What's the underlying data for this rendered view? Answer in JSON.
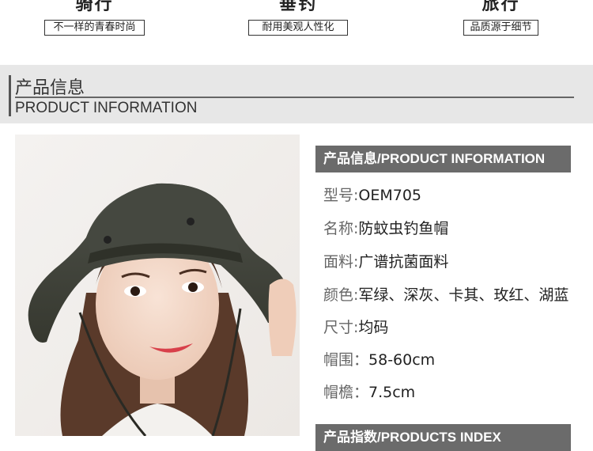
{
  "features": [
    {
      "name": "骑行",
      "tag": "不一样的青春时尚"
    },
    {
      "name": "垂钓",
      "tag": "耐用美观人性化"
    },
    {
      "name": "旅行",
      "tag": "品质源于细节"
    }
  ],
  "section": {
    "title_cn": "产品信息",
    "title_en": "PRODUCT INFORMATION"
  },
  "panel": {
    "header": "产品信息/PRODUCT INFORMATION",
    "specs": [
      {
        "key": "型号:",
        "value": "OEM705"
      },
      {
        "key": "名称:",
        "value": "防蚊虫钓鱼帽"
      },
      {
        "key": "面料:",
        "value": "广谱抗菌面料"
      },
      {
        "key": "颜色:",
        "value": "军绿、深灰、卡其、玫红、湖蓝"
      },
      {
        "key": "尺寸:",
        "value": "均码"
      },
      {
        "key": "帽围：",
        "value": "58-60cm"
      },
      {
        "key": "帽檐：",
        "value": "7.5cm"
      }
    ],
    "footer": "产品指数/PRODUCTS INDEX"
  }
}
